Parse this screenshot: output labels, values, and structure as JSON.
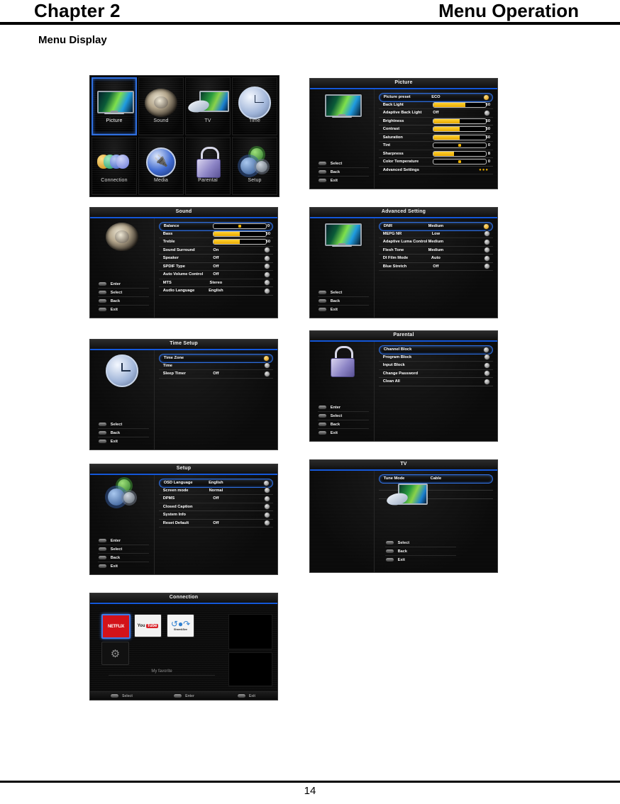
{
  "page": {
    "chapter": "Chapter 2",
    "chapter_title": "Menu Operation",
    "section": "Menu Display",
    "page_number": "14"
  },
  "main_menu": {
    "tiles": [
      {
        "label": "Picture",
        "icon": "tv-screen-icon",
        "selected": true
      },
      {
        "label": "Sound",
        "icon": "speaker-icon",
        "selected": false
      },
      {
        "label": "TV",
        "icon": "satellite-tv-icon",
        "selected": false
      },
      {
        "label": "Time",
        "icon": "clock-icon",
        "selected": false
      },
      {
        "label": "Connection",
        "icon": "network-dots-icon",
        "selected": false
      },
      {
        "label": "Media",
        "icon": "usb-media-icon",
        "selected": false
      },
      {
        "label": "Parental",
        "icon": "padlock-icon",
        "selected": false
      },
      {
        "label": "Setup",
        "icon": "gears-icon",
        "selected": false
      }
    ]
  },
  "picture_menu": {
    "title": "Picture",
    "icon": "tv-screen-icon",
    "buttons": [
      {
        "label": "Select",
        "icon": "oval-button-icon"
      },
      {
        "label": "Back",
        "icon": "oval-button-icon"
      },
      {
        "label": "Exit",
        "icon": "oval-button-icon"
      }
    ],
    "rows": [
      {
        "label": "Picture preset",
        "value": "ECO",
        "type": "value",
        "selected": true,
        "right": "info-amber-icon"
      },
      {
        "label": "Back Light",
        "value": "60",
        "type": "slider",
        "fill": 62,
        "selected": false
      },
      {
        "label": "Adaptive Back Light",
        "value": "Off",
        "type": "value",
        "selected": false,
        "right": "info-icon"
      },
      {
        "label": "Brightness",
        "value": "50",
        "type": "slider",
        "fill": 50,
        "selected": false
      },
      {
        "label": "Contrast",
        "value": "50",
        "type": "slider",
        "fill": 50,
        "selected": false
      },
      {
        "label": "Saturation",
        "value": "50",
        "type": "slider",
        "fill": 50,
        "selected": false
      },
      {
        "label": "Tint",
        "value": "0",
        "type": "dot",
        "fill": 50,
        "selected": false
      },
      {
        "label": "Sharpness",
        "value": "8",
        "type": "slider",
        "fill": 40,
        "selected": false
      },
      {
        "label": "Color Temperature",
        "value": "0",
        "type": "dot",
        "fill": 50,
        "selected": false
      },
      {
        "label": "Advanced Settings",
        "value": "",
        "type": "dots",
        "selected": false
      }
    ]
  },
  "sound_menu": {
    "title": "Sound",
    "icon": "speaker-icon",
    "buttons": [
      {
        "label": "Enter",
        "icon": "oval-button-icon"
      },
      {
        "label": "Select",
        "icon": "oval-button-icon"
      },
      {
        "label": "Back",
        "icon": "oval-button-icon"
      },
      {
        "label": "Exit",
        "icon": "oval-button-icon"
      }
    ],
    "rows": [
      {
        "label": "Balance",
        "value": "0",
        "type": "dot",
        "fill": 50,
        "selected": true
      },
      {
        "label": "Bass",
        "value": "50",
        "type": "slider",
        "fill": 50,
        "selected": false
      },
      {
        "label": "Treble",
        "value": "50",
        "type": "slider",
        "fill": 50,
        "selected": false
      },
      {
        "label": "Sound Surround",
        "value": "On",
        "type": "value",
        "selected": false,
        "right": "info-icon"
      },
      {
        "label": "Speaker",
        "value": "Off",
        "type": "value",
        "selected": false,
        "right": "info-icon"
      },
      {
        "label": "SPDIF Type",
        "value": "Off",
        "type": "value",
        "selected": false,
        "right": "info-icon"
      },
      {
        "label": "Auto Volume Control",
        "value": "Off",
        "type": "value",
        "selected": false,
        "right": "info-icon"
      },
      {
        "label": "MTS",
        "value": "Stereo",
        "type": "value",
        "selected": false,
        "right": "info-icon"
      },
      {
        "label": "Audio Language",
        "value": "English",
        "type": "value",
        "selected": false,
        "right": "info-icon"
      }
    ]
  },
  "advanced_menu": {
    "title": "Advanced Setting",
    "icon": "tv-screen-icon",
    "buttons": [
      {
        "label": "Select",
        "icon": "oval-button-icon"
      },
      {
        "label": "Back",
        "icon": "oval-button-icon"
      },
      {
        "label": "Exit",
        "icon": "oval-button-icon"
      }
    ],
    "rows": [
      {
        "label": "DNR",
        "value": "Medium",
        "type": "value",
        "selected": true,
        "right": "info-amber-icon"
      },
      {
        "label": "MEPG NR",
        "value": "Low",
        "type": "value",
        "selected": false,
        "right": "info-icon"
      },
      {
        "label": "Adaptive Luma Control",
        "value": "Medium",
        "type": "value",
        "selected": false,
        "right": "info-icon"
      },
      {
        "label": "Flesh Tone",
        "value": "Medium",
        "type": "value",
        "selected": false,
        "right": "info-icon"
      },
      {
        "label": "DI Film Mode",
        "value": "Auto",
        "type": "value",
        "selected": false,
        "right": "info-icon"
      },
      {
        "label": "Blue Stretch",
        "value": "Off",
        "type": "value",
        "selected": false,
        "right": "info-icon"
      }
    ]
  },
  "time_menu": {
    "title": "Time Setup",
    "icon": "clock-icon",
    "buttons": [
      {
        "label": "Select",
        "icon": "oval-button-icon"
      },
      {
        "label": "Back",
        "icon": "oval-button-icon"
      },
      {
        "label": "Exit",
        "icon": "oval-button-icon"
      }
    ],
    "rows": [
      {
        "label": "Time Zone",
        "value": "",
        "type": "value",
        "selected": true,
        "right": "info-amber-icon"
      },
      {
        "label": "Time",
        "value": "",
        "type": "value",
        "selected": false,
        "right": "info-icon"
      },
      {
        "label": "Sleep Timer",
        "value": "Off",
        "type": "value",
        "selected": false,
        "right": "info-icon"
      }
    ]
  },
  "parental_menu": {
    "title": "Parental",
    "icon": "padlock-icon",
    "buttons": [
      {
        "label": "Enter",
        "icon": "oval-button-icon"
      },
      {
        "label": "Select",
        "icon": "oval-button-icon"
      },
      {
        "label": "Back",
        "icon": "oval-button-icon"
      },
      {
        "label": "Exit",
        "icon": "oval-button-icon"
      }
    ],
    "rows": [
      {
        "label": "Channel Block",
        "value": "",
        "type": "value",
        "selected": true,
        "right": "info-icon"
      },
      {
        "label": "Program Block",
        "value": "",
        "type": "value",
        "selected": false,
        "right": "info-icon"
      },
      {
        "label": "Input Block",
        "value": "",
        "type": "value",
        "selected": false,
        "right": "info-icon"
      },
      {
        "label": "Change Password",
        "value": "",
        "type": "value",
        "selected": false,
        "right": "info-icon"
      },
      {
        "label": "Clean All",
        "value": "",
        "type": "value",
        "selected": false,
        "right": "info-icon"
      }
    ]
  },
  "setup_menu": {
    "title": "Setup",
    "icon": "gears-icon",
    "buttons": [
      {
        "label": "Enter",
        "icon": "oval-button-icon"
      },
      {
        "label": "Select",
        "icon": "oval-button-icon"
      },
      {
        "label": "Back",
        "icon": "oval-button-icon"
      },
      {
        "label": "Exit",
        "icon": "oval-button-icon"
      }
    ],
    "rows": [
      {
        "label": "OSD Language",
        "value": "English",
        "type": "value",
        "selected": true,
        "right": "info-icon"
      },
      {
        "label": "Screen mode",
        "value": "Normal",
        "type": "value",
        "selected": false,
        "right": "info-icon"
      },
      {
        "label": "DPMS",
        "value": "Off",
        "type": "value",
        "selected": false,
        "right": "info-icon"
      },
      {
        "label": "Closed Caption",
        "value": "",
        "type": "value",
        "selected": false,
        "right": "info-icon"
      },
      {
        "label": "System Info",
        "value": "",
        "type": "value",
        "selected": false,
        "right": "info-icon"
      },
      {
        "label": "Reset Default",
        "value": "Off",
        "type": "value",
        "selected": false,
        "right": "info-icon"
      }
    ]
  },
  "tv_menu": {
    "title": "TV",
    "icon": "satellite-tv-icon",
    "buttons": [
      {
        "label": "Select",
        "icon": "oval-button-icon"
      },
      {
        "label": "Back",
        "icon": "oval-button-icon"
      },
      {
        "label": "Exit",
        "icon": "oval-button-icon"
      }
    ],
    "rows": [
      {
        "label": "Tune Mode",
        "value": "Cable",
        "type": "value",
        "selected": true
      },
      {
        "label": "",
        "value": "",
        "type": "value",
        "selected": false
      },
      {
        "label": "",
        "value": "",
        "type": "value",
        "selected": false
      }
    ]
  },
  "connection_menu": {
    "title": "Connection",
    "favorite_label": "My favorite",
    "apps": [
      {
        "label": "NETFLIX",
        "icon": "netflix-icon",
        "selected": true
      },
      {
        "label": "You Tube",
        "icon": "youtube-icon",
        "selected": false
      },
      {
        "label": "Share&See",
        "icon": "share-see-icon",
        "selected": false
      },
      {
        "label": "",
        "icon": "gear-icon",
        "selected": false
      }
    ],
    "bottom_bar": [
      {
        "label": "Select",
        "icon": "oval-button-icon"
      },
      {
        "label": "Enter",
        "icon": "oval-button-icon"
      },
      {
        "label": "Exit",
        "icon": "oval-button-icon"
      }
    ]
  },
  "colors": {
    "accent_blue": "#1457d8",
    "highlight_border": "#2f6fe0",
    "slider_fill": "#e8a800",
    "panel_bg": "#0a0a0a"
  }
}
